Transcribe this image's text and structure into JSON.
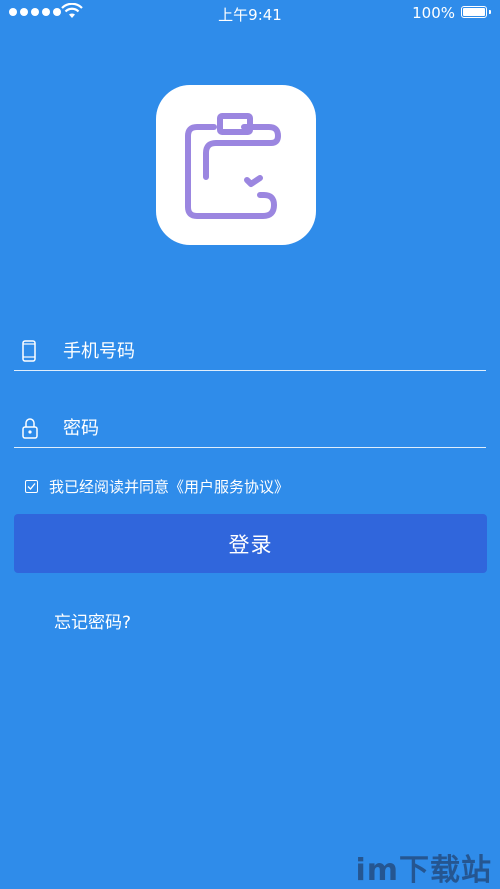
{
  "status_bar": {
    "time": "上午9:41",
    "battery": "100%",
    "icons": [
      "signal-dots-icon",
      "wifi-icon",
      "battery-icon"
    ]
  },
  "app_logo": {
    "icon": "wallet-note-icon",
    "color": "#9b86e0"
  },
  "form": {
    "phone": {
      "placeholder": "手机号码",
      "value": "",
      "icon": "phone-icon"
    },
    "password": {
      "placeholder": "密码",
      "value": "",
      "icon": "lock-icon"
    },
    "agreement": {
      "checked": true,
      "text": "我已经阅读并同意《用户服务协议》"
    },
    "login_label": "登录",
    "forgot_label": "忘记密码?"
  },
  "watermark": "im下载站",
  "colors": {
    "background": "#2f8cea",
    "button": "#3066dc",
    "text": "#ffffff"
  }
}
